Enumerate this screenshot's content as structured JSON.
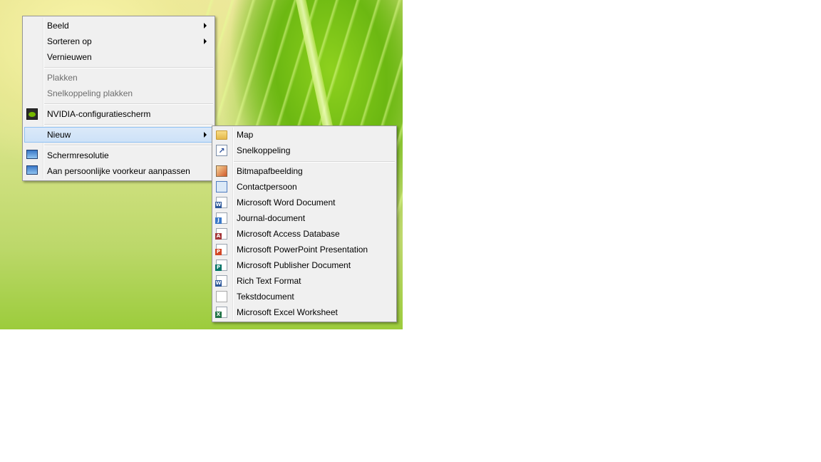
{
  "context_menu": {
    "items": [
      {
        "label": "Beeld",
        "submenu": true,
        "disabled": false
      },
      {
        "label": "Sorteren op",
        "submenu": true,
        "disabled": false
      },
      {
        "label": "Vernieuwen",
        "submenu": false,
        "disabled": false
      },
      {
        "label": "Plakken",
        "submenu": false,
        "disabled": true
      },
      {
        "label": "Snelkoppeling plakken",
        "submenu": false,
        "disabled": true
      },
      {
        "label": "NVIDIA-configuratiescherm",
        "submenu": false,
        "disabled": false,
        "icon": "nvidia-icon"
      },
      {
        "label": "Nieuw",
        "submenu": true,
        "disabled": false,
        "highlighted": true
      },
      {
        "label": "Schermresolutie",
        "submenu": false,
        "disabled": false,
        "icon": "monitor-icon"
      },
      {
        "label": "Aan persoonlijke voorkeur aanpassen",
        "submenu": false,
        "disabled": false,
        "icon": "personalize-icon"
      }
    ]
  },
  "new_submenu": {
    "items": [
      {
        "label": "Map",
        "icon": "folder-icon"
      },
      {
        "label": "Snelkoppeling",
        "icon": "shortcut-icon"
      },
      {
        "label": "Bitmapafbeelding",
        "icon": "bitmap-icon"
      },
      {
        "label": "Contactpersoon",
        "icon": "contact-icon"
      },
      {
        "label": "Microsoft Word Document",
        "icon": "word-icon",
        "badge": "W",
        "badge_color": "#2b579a"
      },
      {
        "label": "Journal-document",
        "icon": "journal-icon"
      },
      {
        "label": "Microsoft Access Database",
        "icon": "access-icon",
        "badge": "A",
        "badge_color": "#a4373a"
      },
      {
        "label": "Microsoft PowerPoint Presentation",
        "icon": "powerpoint-icon",
        "badge": "P",
        "badge_color": "#d24726"
      },
      {
        "label": "Microsoft Publisher Document",
        "icon": "publisher-icon",
        "badge": "P",
        "badge_color": "#077568"
      },
      {
        "label": "Rich Text Format",
        "icon": "rtf-icon",
        "badge": "W",
        "badge_color": "#2b579a"
      },
      {
        "label": "Tekstdocument",
        "icon": "text-document-icon"
      },
      {
        "label": "Microsoft Excel Worksheet",
        "icon": "excel-icon",
        "badge": "X",
        "badge_color": "#217346"
      }
    ]
  }
}
